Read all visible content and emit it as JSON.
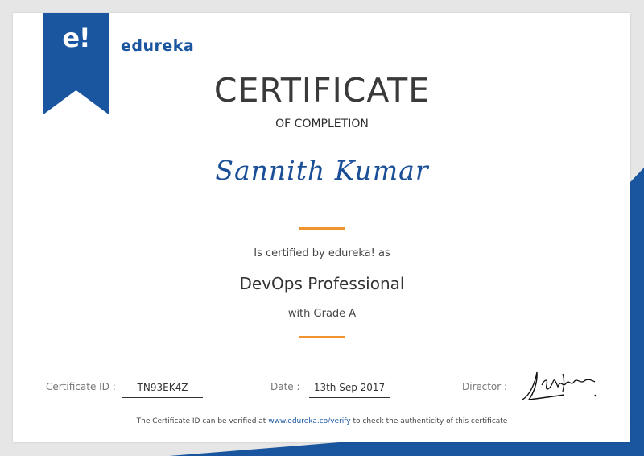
{
  "brand": {
    "logo_mark": "e!",
    "name": "edureka"
  },
  "certificate": {
    "title": "CERTIFICATE",
    "subtitle": "OF COMPLETION",
    "recipient": "Sannith Kumar",
    "certified_text": "Is certified by edureka! as",
    "course": "DevOps Professional",
    "grade_text": "with Grade A"
  },
  "fields": {
    "id_label": "Certificate ID :",
    "id_value": "TN93EK4Z",
    "date_label": "Date :",
    "date_value": "13th Sep 2017",
    "director_label": "Director :"
  },
  "footer": {
    "prefix": "The Certificate ID can be verified at ",
    "link": "www.edureka.co/verify",
    "suffix": " to check the authenticity of this certificate"
  },
  "colors": {
    "brand_blue": "#1a56a0",
    "accent_orange": "#f0922e",
    "text_dark": "#333333"
  }
}
